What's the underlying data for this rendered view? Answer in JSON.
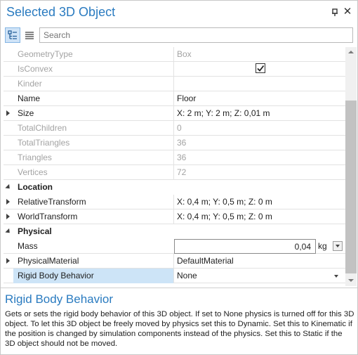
{
  "window": {
    "title": "Selected 3D Object"
  },
  "toolbar": {
    "search_placeholder": "Search",
    "categorized_icon": "categorized-view-icon",
    "alphabetical_icon": "alphabetical-view-icon"
  },
  "rows": [
    {
      "name": "GeometryType",
      "value": "Box"
    },
    {
      "name": "IsConvex",
      "value": "",
      "checked": true
    },
    {
      "name": "Kinder",
      "value": ""
    },
    {
      "name": "Name",
      "value": "Floor"
    },
    {
      "name": "Size",
      "value": "X: 2 m; Y: 2 m; Z: 0,01 m"
    },
    {
      "name": "TotalChildren",
      "value": "0"
    },
    {
      "name": "TotalTriangles",
      "value": "36"
    },
    {
      "name": "Triangles",
      "value": "36"
    },
    {
      "name": "Vertices",
      "value": "72"
    },
    {
      "name": "Location",
      "value": ""
    },
    {
      "name": "RelativeTransform",
      "value": "X: 0,4 m; Y: 0,5 m; Z: 0 m"
    },
    {
      "name": "WorldTransform",
      "value": "X: 0,4 m; Y: 0,5 m; Z: 0 m"
    },
    {
      "name": "Physical",
      "value": ""
    },
    {
      "name": "Mass",
      "value": "0,04",
      "unit": "kg"
    },
    {
      "name": "PhysicalMaterial",
      "value": "DefaultMaterial"
    },
    {
      "name": "Rigid Body Behavior",
      "value": "None"
    }
  ],
  "description": {
    "title": "Rigid Body Behavior",
    "text": "Gets or sets the rigid body behavior of this 3D object. If set to None physics is turned off for this 3D object. To let this 3D object be freely moved by physics set this to Dynamic. Set this to Kinematic if the position is changed by simulation components instead of the physics. Set this to Static if the 3D object should not be moved."
  },
  "colors": {
    "accent": "#2a7bc0",
    "selection": "#cde4f7",
    "disabled_text": "#a3a3a3"
  }
}
